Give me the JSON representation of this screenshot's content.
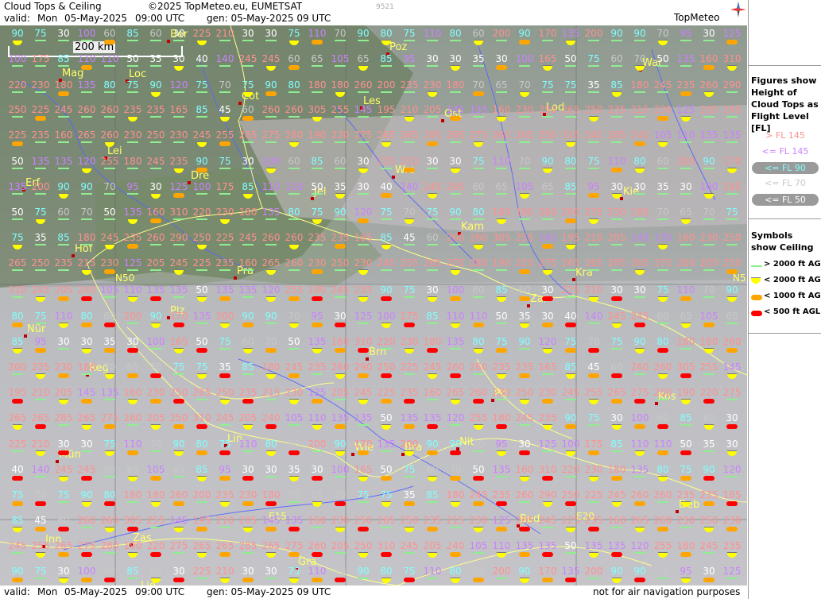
{
  "header": {
    "title": "Cloud Tops & Ceiling",
    "copyright": "©2025 TopMeteo.eu, EUMETSAT",
    "frame_id": "9521",
    "valid_label": "valid:",
    "valid_day": "Mon",
    "valid_date": "05-May-2025",
    "valid_time": "09:00 UTC",
    "gen": "gen: 05-May-2025 09 UTC",
    "brand": "TopMeteo"
  },
  "footer": {
    "valid_label": "valid:",
    "valid_day": "Mon",
    "valid_date": "05-May-2025",
    "valid_time": "09:00 UTC",
    "gen": "gen: 05-May-2025 09 UTC",
    "disclaimer": "not for air navigation purposes"
  },
  "scale": {
    "label": "200 km"
  },
  "legend": {
    "figures_title": "Figures show Height of Cloud Tops as Flight Level [FL]",
    "levels": [
      {
        "label": "> FL 145",
        "color": "#ff9090"
      },
      {
        "label": "<= FL 145",
        "color": "#cc80ff"
      },
      {
        "label": "<= FL 90",
        "color": "#80ffff"
      },
      {
        "label": "<= FL 70",
        "color": "#c8c8c8"
      },
      {
        "label": "<= FL 50",
        "color": "#ffffff"
      }
    ],
    "symbols_title": "Symbols show Ceiling",
    "symbols": [
      {
        "label": "> 2000 ft AGL",
        "color": "#90ee90",
        "shape": "line"
      },
      {
        "label": "< 2000 ft AGL",
        "color": "#ffff00",
        "shape": "half"
      },
      {
        "label": "< 1000 ft AGL",
        "color": "#ffa500",
        "shape": "pill"
      },
      {
        "label": "< 500 ft AGL",
        "color": "#ff0000",
        "shape": "pill"
      }
    ]
  },
  "colors": {
    "pink": "#ff9090",
    "violet": "#cc80ff",
    "cyan": "#80ffff",
    "gray": "#c8c8c8",
    "white": "#ffffff",
    "city": "#ffff66",
    "border": "#ffff88",
    "river": "#5566ff"
  },
  "cities": [
    "Ber",
    "Poz",
    "War",
    "Mag",
    "Loc",
    "Cot",
    "Les",
    "Lod",
    "Ost",
    "Lei",
    "Dre",
    "Wro",
    "Erf",
    "Jel",
    "Kie",
    "Kam",
    "Hof",
    "Pra",
    "Kra",
    "Zar",
    "Plz",
    "Nür",
    "Brn",
    "Reg",
    "Pri",
    "Kos",
    "Nit",
    "Lin",
    "Wie",
    "Bra",
    "Mün",
    "Deb",
    "Bud",
    "Inn",
    "Zas",
    "Gra",
    "Lie"
  ],
  "grid_labels": [
    "N50",
    "E15",
    "E20",
    "N5"
  ],
  "cloud_tops": [
    "90",
    "75",
    "30",
    "100",
    "60",
    "85",
    "60",
    "30",
    "225",
    "210",
    "30",
    "30",
    "75",
    "110",
    "70",
    "90",
    "80",
    "75",
    "110",
    "80",
    "60",
    "200",
    "90",
    "170",
    "135",
    "200",
    "90",
    "90",
    "70",
    "95",
    "30",
    "125",
    "100",
    "175",
    "85",
    "110",
    "110",
    "50",
    "35",
    "30",
    "40",
    "140",
    "245",
    "245",
    "60",
    "65",
    "105",
    "65",
    "85",
    "95",
    "30",
    "30",
    "35",
    "30",
    "100",
    "165",
    "50",
    "75",
    "60",
    "70",
    "50",
    "135",
    "160",
    "310",
    "220",
    "230",
    "180",
    "135",
    "80",
    "75",
    "90",
    "120",
    "75",
    "70",
    "75",
    "90",
    "80",
    "180",
    "180",
    "260",
    "200",
    "235",
    "230",
    "180",
    "70",
    "65",
    "70",
    "75",
    "75",
    "35",
    "85",
    "180",
    "245",
    "235",
    "260",
    "290",
    "250",
    "225",
    "245",
    "260",
    "260",
    "235",
    "235",
    "165",
    "85",
    "45",
    "60",
    "260",
    "260",
    "305",
    "255",
    "145",
    "195",
    "210",
    "205",
    "145",
    "135",
    "160",
    "230",
    "250",
    "265",
    "250",
    "235",
    "215",
    "230",
    "125",
    "205",
    "245",
    "225",
    "235",
    "160",
    "265",
    "260",
    "230",
    "250",
    "230",
    "245",
    "255",
    "265",
    "275",
    "280",
    "190",
    "220",
    "275",
    "265",
    "265",
    "285",
    "265",
    "275",
    "260",
    "205",
    "250",
    "310",
    "245",
    "205",
    "240",
    "105",
    "110",
    "135",
    "135",
    "50",
    "135",
    "135",
    "120",
    "255",
    "180",
    "245",
    "235"
  ],
  "ceiling_counts": {
    "green": "> 2000 ft AGL",
    "yellow": "< 2000 ft AGL",
    "orange": "< 1000 ft AGL",
    "red": "< 500 ft AGL"
  }
}
